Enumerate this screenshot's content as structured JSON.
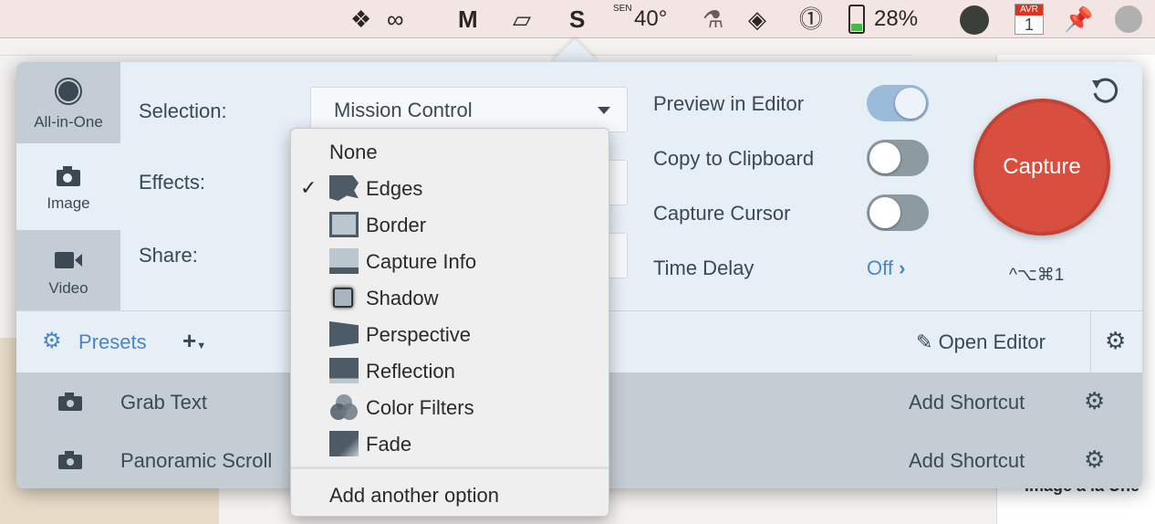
{
  "menubar": {
    "weather_dir": "SEN",
    "weather_temp": "40°",
    "battery": "28%",
    "calendar_month": "AVR",
    "calendar_day": "1",
    "icons": [
      "dropbox-icon",
      "creative-cloud-icon",
      "mailplane-icon",
      "drive-icon",
      "s-icon",
      "flask-icon",
      "diamond-icon",
      "1password-icon",
      "battery-icon",
      "activity-icon",
      "calendar-icon",
      "pin-icon",
      "moon-icon"
    ]
  },
  "tabs": [
    {
      "label": "All-in-One",
      "icon": "record-icon"
    },
    {
      "label": "Image",
      "icon": "camera-icon"
    },
    {
      "label": "Video",
      "icon": "video-icon"
    }
  ],
  "labels": {
    "selection": "Selection:",
    "effects": "Effects:",
    "share": "Share:"
  },
  "selection_value": "Mission Control",
  "options": [
    {
      "label": "Preview in Editor",
      "on": true
    },
    {
      "label": "Copy to Clipboard",
      "on": false
    },
    {
      "label": "Capture Cursor",
      "on": false
    }
  ],
  "time_delay": {
    "label": "Time Delay",
    "value": "Off"
  },
  "capture": {
    "label": "Capture",
    "shortcut": "^⌥⌘1",
    "color": "#d94f3f"
  },
  "bottom": {
    "presets": "Presets",
    "add": "+",
    "open_editor": "Open Editor"
  },
  "presets": [
    {
      "name": "Grab Text",
      "shortcut": "Add Shortcut"
    },
    {
      "name": "Panoramic Scroll",
      "shortcut": "Add Shortcut"
    }
  ],
  "effects_menu": {
    "items": [
      "None",
      "Edges",
      "Border",
      "Capture Info",
      "Shadow",
      "Perspective",
      "Reflection",
      "Color Filters",
      "Fade"
    ],
    "checked": "Edges",
    "footer": "Add another option"
  },
  "background": {
    "right_text": "Image à la Une"
  }
}
